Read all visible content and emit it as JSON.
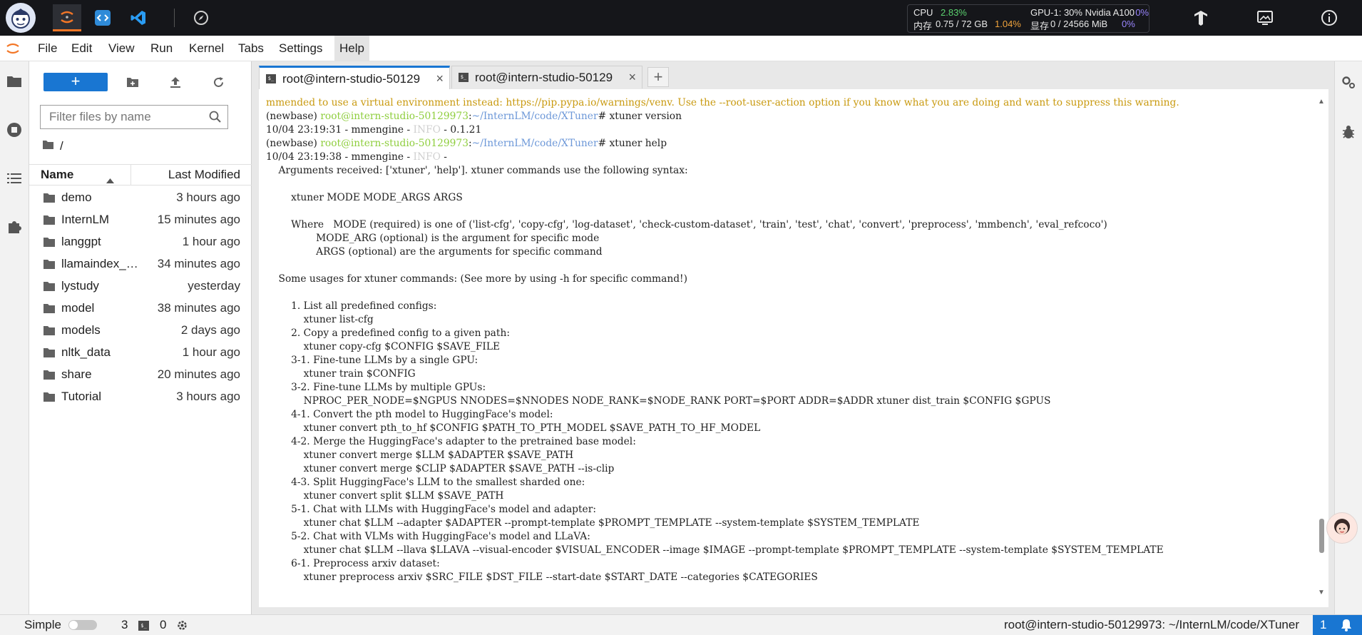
{
  "topbar": {
    "metrics": {
      "cpu_label": "CPU",
      "cpu_value": "2.83%",
      "mem_label": "内存",
      "mem_value": "0.75 / 72 GB",
      "mem_pct": "1.04%",
      "gpu_label": "GPU-1: 30% Nvidia A100",
      "gpu_pct": "0%",
      "vram_label": "显存",
      "vram_value": "0 / 24566 MiB",
      "vram_pct": "0%"
    }
  },
  "menu": [
    "File",
    "Edit",
    "View",
    "Run",
    "Kernel",
    "Tabs",
    "Settings",
    "Help"
  ],
  "file_browser": {
    "search_placeholder": "Filter files by name",
    "breadcrumb": "/",
    "col_name": "Name",
    "col_modified": "Last Modified",
    "rows": [
      {
        "name": "demo",
        "modified": "3 hours ago"
      },
      {
        "name": "InternLM",
        "modified": "15 minutes ago"
      },
      {
        "name": "langgpt",
        "modified": "1 hour ago"
      },
      {
        "name": "llamaindex_demo",
        "modified": "34 minutes ago"
      },
      {
        "name": "lystudy",
        "modified": "yesterday"
      },
      {
        "name": "model",
        "modified": "38 minutes ago"
      },
      {
        "name": "models",
        "modified": "2 days ago"
      },
      {
        "name": "nltk_data",
        "modified": "1 hour ago"
      },
      {
        "name": "share",
        "modified": "20 minutes ago"
      },
      {
        "name": "Tutorial",
        "modified": "3 hours ago"
      }
    ]
  },
  "tabs": [
    {
      "label": "root@intern-studio-50129",
      "close": "×"
    },
    {
      "label": "root@intern-studio-50129",
      "close": "×"
    }
  ],
  "tab_add": "+",
  "terminal": {
    "warning": "mmended to use a virtual environment instead: https://pip.pypa.io/warnings/venv. Use the --root-user-action option if you know what you are doing and want to suppress this warning.",
    "env": "(newbase) ",
    "host": "root@intern-studio-50129973",
    "colon": ":",
    "path": "~/InternLM/code/XTuner",
    "hash": "# ",
    "cmd1": "xtuner version",
    "log1_prefix": "10/04 23:19:31 - mmengine - ",
    "log_level": "INFO",
    "log1_suffix": " - 0.1.21",
    "cmd2": "xtuner help",
    "log2_prefix": "10/04 23:19:38 - mmengine - ",
    "log2_suffix": " - ",
    "body": [
      "    Arguments received: ['xtuner', 'help']. xtuner commands use the following syntax:",
      "",
      "        xtuner MODE MODE_ARGS ARGS",
      "",
      "        Where   MODE (required) is one of ('list-cfg', 'copy-cfg', 'log-dataset', 'check-custom-dataset', 'train', 'test', 'chat', 'convert', 'preprocess', 'mmbench', 'eval_refcoco')",
      "                MODE_ARG (optional) is the argument for specific mode",
      "                ARGS (optional) are the arguments for specific command",
      "",
      "    Some usages for xtuner commands: (See more by using -h for specific command!)",
      "",
      "        1. List all predefined configs:",
      "            xtuner list-cfg",
      "        2. Copy a predefined config to a given path:",
      "            xtuner copy-cfg $CONFIG $SAVE_FILE",
      "        3-1. Fine-tune LLMs by a single GPU:",
      "            xtuner train $CONFIG",
      "        3-2. Fine-tune LLMs by multiple GPUs:",
      "            NPROC_PER_NODE=$NGPUS NNODES=$NNODES NODE_RANK=$NODE_RANK PORT=$PORT ADDR=$ADDR xtuner dist_train $CONFIG $GPUS",
      "        4-1. Convert the pth model to HuggingFace's model:",
      "            xtuner convert pth_to_hf $CONFIG $PATH_TO_PTH_MODEL $SAVE_PATH_TO_HF_MODEL",
      "        4-2. Merge the HuggingFace's adapter to the pretrained base model:",
      "            xtuner convert merge $LLM $ADAPTER $SAVE_PATH",
      "            xtuner convert merge $CLIP $ADAPTER $SAVE_PATH --is-clip",
      "        4-3. Split HuggingFace's LLM to the smallest sharded one:",
      "            xtuner convert split $LLM $SAVE_PATH",
      "        5-1. Chat with LLMs with HuggingFace's model and adapter:",
      "            xtuner chat $LLM --adapter $ADAPTER --prompt-template $PROMPT_TEMPLATE --system-template $SYSTEM_TEMPLATE",
      "        5-2. Chat with VLMs with HuggingFace's model and LLaVA:",
      "            xtuner chat $LLM --llava $LLAVA --visual-encoder $VISUAL_ENCODER --image $IMAGE --prompt-template $PROMPT_TEMPLATE --system-template $SYSTEM_TEMPLATE",
      "        6-1. Preprocess arxiv dataset:",
      "            xtuner preprocess arxiv $SRC_FILE $DST_FILE --start-date $START_DATE --categories $CATEGORIES"
    ]
  },
  "statusbar": {
    "mode": "Simple",
    "kernels": "3",
    "terminals": "0",
    "path": "root@intern-studio-50129973: ~/InternLM/code/XTuner",
    "notif_count": "1"
  }
}
